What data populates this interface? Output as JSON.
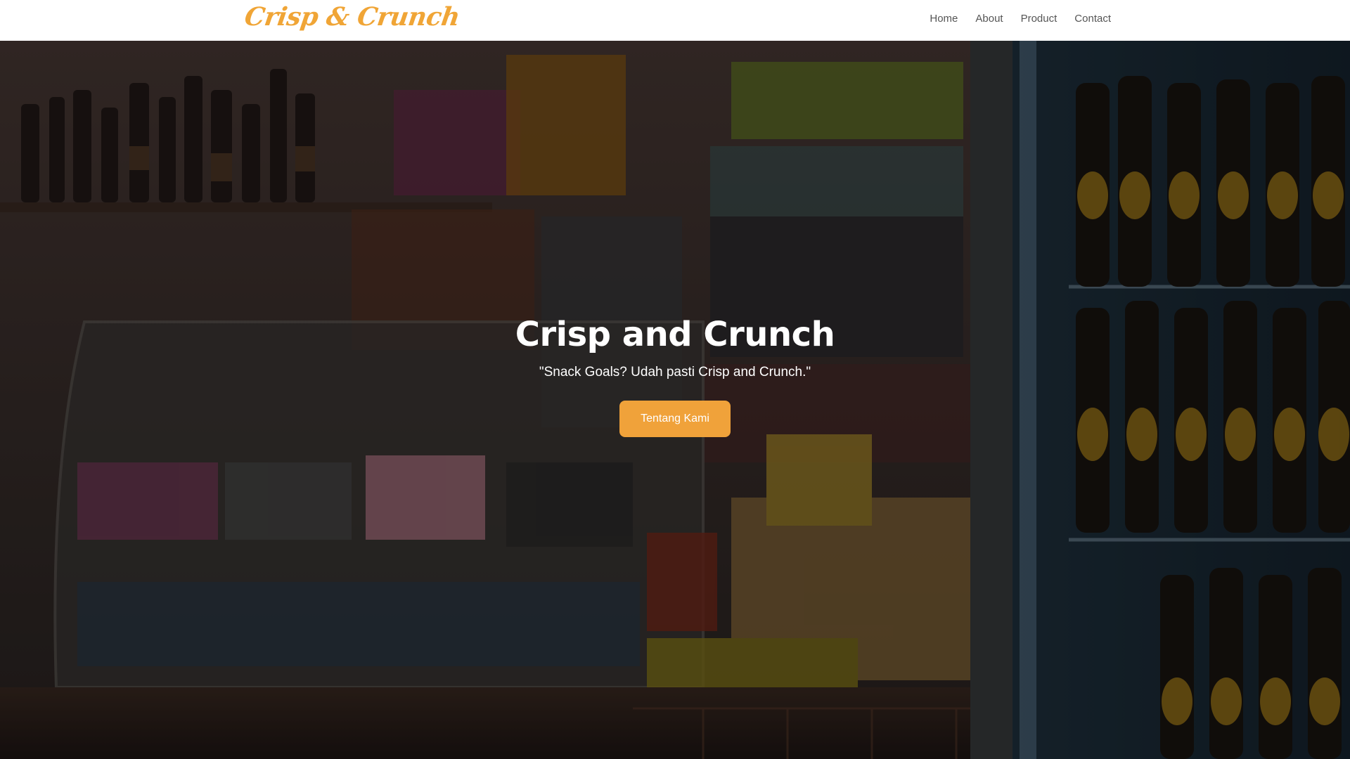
{
  "brand": {
    "logo_text": "Crisp & Crunch",
    "accent_color": "#f0a536"
  },
  "nav": {
    "items": [
      {
        "label": "Home"
      },
      {
        "label": "About"
      },
      {
        "label": "Product"
      },
      {
        "label": "Contact"
      }
    ]
  },
  "hero": {
    "title": "Crisp and Crunch",
    "tagline": "\"Snack Goals? Udah pasti Crisp and Crunch.\"",
    "button_label": "Tentang Kami",
    "button_color": "#f0a23a",
    "background_image": "dark-photo-of-convenience-store-snack-counter"
  }
}
